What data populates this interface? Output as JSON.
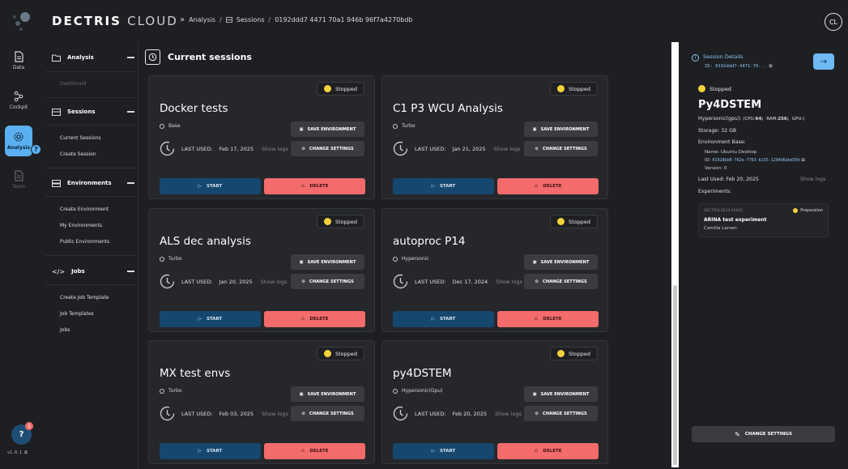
{
  "app": {
    "logo_bold": "DECTRIS",
    "logo_light": "CLOUD"
  },
  "breadcrumb": {
    "item1": "Analysis",
    "sep1": "/",
    "item2": "Sessions",
    "sep2": "/",
    "item3": "0192ddd7 4471 70a1 946b 96f7a4270bdb"
  },
  "user": {
    "initials": "CL"
  },
  "rail": {
    "data": "Data",
    "cockpit": "Cockpit",
    "analysis": "Analysis",
    "team": "Team",
    "help_badge": "?",
    "help_fab": "?",
    "notif_count": "1",
    "version": "v1.0.1"
  },
  "subnav": {
    "analysis": {
      "title": "Analysis",
      "items": [
        "Dashboard"
      ]
    },
    "sessions": {
      "title": "Sessions",
      "items": [
        "Current Sessions",
        "Create Session"
      ]
    },
    "environments": {
      "title": "Environments",
      "items": [
        "Create Environment",
        "My Environments",
        "Public Environments"
      ]
    },
    "jobs": {
      "title": "Jobs",
      "items": [
        "Create Job Template",
        "Job Templates",
        "Jobs"
      ]
    }
  },
  "main": {
    "title": "Current sessions"
  },
  "labels": {
    "save_env": "SAVE ENVIRONMENT",
    "change_settings": "CHANGE SETTINGS",
    "last_used": "LAST USED:",
    "show_logs": "Show logs",
    "start": "START",
    "delete": "DELETE"
  },
  "sessions": [
    {
      "name": "Docker tests",
      "status": "Stopped",
      "base": "Base",
      "last_used": "Feb 17, 2025"
    },
    {
      "name": "C1 P3 WCU Analysis",
      "status": "Stopped",
      "base": "Turbo",
      "last_used": "Jan 21, 2025"
    },
    {
      "name": "ALS dec analysis",
      "status": "Stopped",
      "base": "Turbo",
      "last_used": "Jan 20, 2025"
    },
    {
      "name": "autoproc P14",
      "status": "Stopped",
      "base": "Hypersonic",
      "last_used": "Dec 17, 2024"
    },
    {
      "name": "MX test envs",
      "status": "Stopped",
      "base": "Turbo",
      "last_used": "Feb 03, 2025"
    },
    {
      "name": "py4DSTEM",
      "status": "Stopped",
      "base": "Hypersonic(Gpu)",
      "last_used": "Feb 20, 2025"
    }
  ],
  "panel": {
    "title": "Session Details",
    "id": "ID: 0192ddd7-4471-70...",
    "status": "Stopped",
    "name": "Py4DSTEM",
    "spec_prefix": "Hypersonic(gpu):",
    "spec_cpu_label": "(CPU:",
    "spec_cpu": "64;",
    "spec_ram_label": "RAM:",
    "spec_ram": "256;",
    "spec_gpu": "GPU:)",
    "storage": "Storage: 32 GB",
    "env_base_label": "Environment Base:",
    "env_name": "Name: Ubuntu Desktop",
    "env_id_label": "ID:",
    "env_id": "01928bb0-762e-7763-b235-1294d6abd35b",
    "env_version": "Version: 0",
    "last_used": "Last Used: Feb 20, 2025",
    "show_logs": "Show logs",
    "experiments_label": "Experiments:",
    "experiment": {
      "code": "DECTRIS SE24 E0835",
      "status": "Preparation",
      "title": "ARINA test experiment",
      "owner": "Camilla Larsen"
    },
    "change_settings": "CHANGE SETTINGS"
  },
  "colors": {
    "accent": "#5ab0f0",
    "stopped": "#f4d23a",
    "delete": "#f36b6b",
    "start": "#16476e",
    "preparation": "#f4d23a"
  }
}
